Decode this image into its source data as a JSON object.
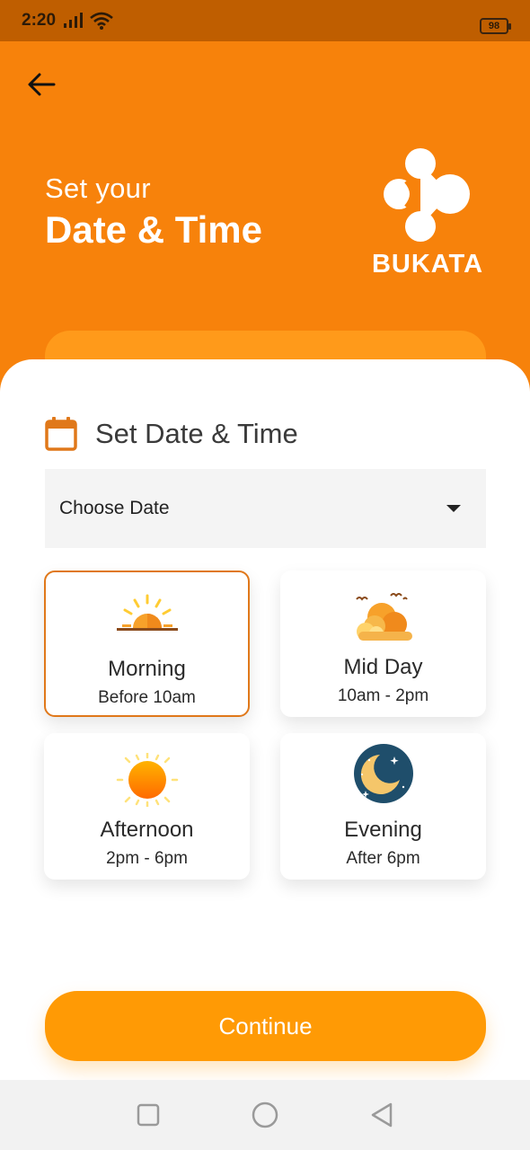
{
  "status_bar": {
    "time": "2:20",
    "battery": "98"
  },
  "header": {
    "subtitle": "Set your",
    "title": "Date & Time",
    "brand": "BUKATA"
  },
  "section": {
    "title": "Set Date & Time"
  },
  "date_select": {
    "value": "Choose Date"
  },
  "time_slots": [
    {
      "name": "Morning",
      "time": "Before 10am",
      "icon": "sunrise-icon",
      "selected": true
    },
    {
      "name": "Mid Day",
      "time": "10am - 2pm",
      "icon": "cloudy-sun-icon",
      "selected": false
    },
    {
      "name": "Afternoon",
      "time": "2pm - 6pm",
      "icon": "sun-icon",
      "selected": false
    },
    {
      "name": "Evening",
      "time": "After 6pm",
      "icon": "moon-icon",
      "selected": false
    }
  ],
  "continue_label": "Continue",
  "colors": {
    "accent": "#f7820b",
    "button": "#ff9a05",
    "selected_border": "#e0781a"
  }
}
